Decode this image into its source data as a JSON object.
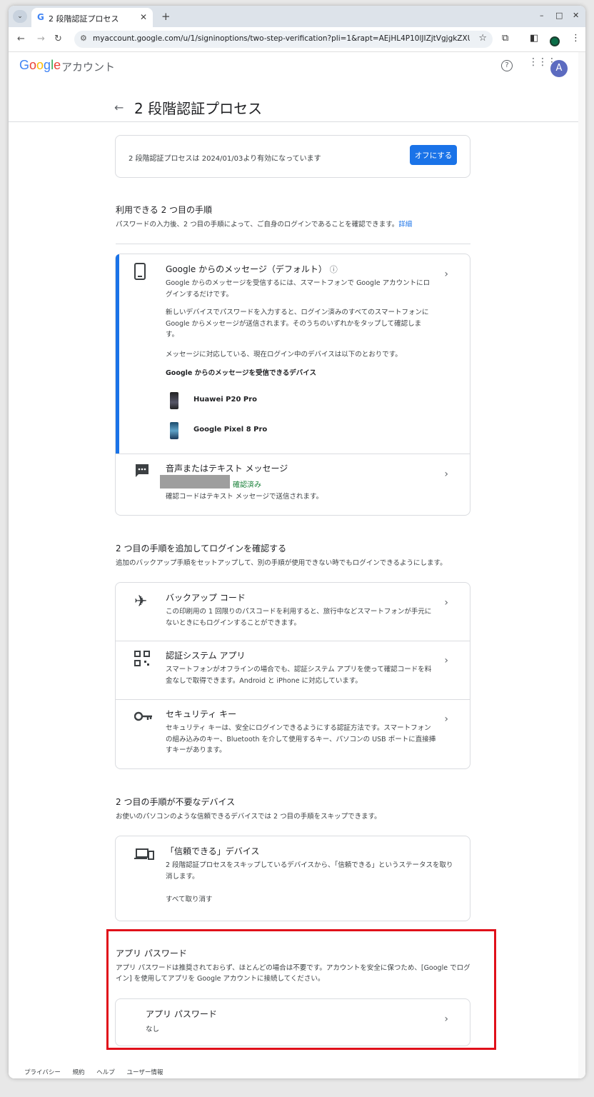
{
  "browser": {
    "tab_title": "2 段階認証プロセス",
    "tab_favicon": "G",
    "tabs_menu": "⌄",
    "new_tab": "+",
    "url": "myaccount.google.com/u/1/signinoptions/two-step-verification?pli=1&rapt=AEjHL4P10lJIZjtVgjgkZXUZKWG...",
    "minimize": "–",
    "maximize": "□",
    "close": "✕"
  },
  "header": {
    "logo": "Google",
    "account_label": "アカウント",
    "avatar_letter": "A"
  },
  "page_title": "2 段階認証プロセス",
  "status": {
    "text": "2 段階認証プロセスは 2024/01/03より有効になっています",
    "button": "オフにする"
  },
  "available_steps": {
    "title": "利用できる 2 つ目の手順",
    "desc": "パスワードの入力後、2 つ目の手順によって、ご自身のログインであることを確認できます。",
    "link": "詳細"
  },
  "google_prompt": {
    "title": "Google からのメッセージ（デフォルト）",
    "desc1": "Google からのメッセージを受信するには、スマートフォンで Google アカウントにログインするだけです。",
    "desc2": "新しいデバイスでパスワードを入力すると、ログイン済みのすべてのスマートフォンに Google からメッセージが送信されます。そのうちのいずれかをタップして確認します。",
    "desc3": "メッセージに対応している、現在ログイン中のデバイスは以下のとおりです。",
    "devices_heading": "Google からのメッセージを受信できるデバイス",
    "devices": [
      "Huawei P20 Pro",
      "Google Pixel 8 Pro"
    ]
  },
  "sms": {
    "title": "音声またはテキスト メッセージ",
    "verified": "確認済み",
    "desc": "確認コードはテキスト メッセージで送信されます。"
  },
  "add_steps": {
    "title": "2 つ目の手順を追加してログインを確認する",
    "desc": "追加のバックアップ手順をセットアップして、別の手順が使用できない時でもログインできるようにします。",
    "items": [
      {
        "title": "バックアップ コード",
        "desc": "この印刷用の 1 回限りのパスコードを利用すると、旅行中などスマートフォンが手元にないときにもログインすることができます。",
        "icon": "airplane-icon"
      },
      {
        "title": "認証システム アプリ",
        "desc": "スマートフォンがオフラインの場合でも、認証システム アプリを使って確認コードを料金なしで取得できます。Android と iPhone に対応しています。",
        "icon": "qr-code-icon"
      },
      {
        "title": "セキュリティ キー",
        "desc": "セキュリティ キーは、安全にログインできるようにする認証方法です。スマートフォンの組み込みのキー、Bluetooth を介して使用するキー、パソコンの USB ポートに直接挿すキーがあります。",
        "icon": "key-icon"
      }
    ]
  },
  "trusted": {
    "title": "2 つ目の手順が不要なデバイス",
    "desc": "お使いのパソコンのような信頼できるデバイスでは 2 つ目の手順をスキップできます。",
    "card_title": "「信頼できる」デバイス",
    "card_desc": "2 段階認証プロセスをスキップしているデバイスから、「信頼できる」というステータスを取り消します。",
    "revoke": "すべて取り消す"
  },
  "app_passwords": {
    "title": "アプリ パスワード",
    "desc": "アプリ パスワードは推奨されておらず、ほとんどの場合は不要です。アカウントを安全に保つため、[Google でログイン] を使用してアプリを Google アカウントに接続してください。",
    "card_title": "アプリ パスワード",
    "card_value": "なし"
  },
  "footer": [
    "プライバシー",
    "規約",
    "ヘルプ",
    "ユーザー情報"
  ],
  "colors": {
    "accent": "#1a73e8",
    "verified": "#188038",
    "highlight": "#e0101a"
  }
}
